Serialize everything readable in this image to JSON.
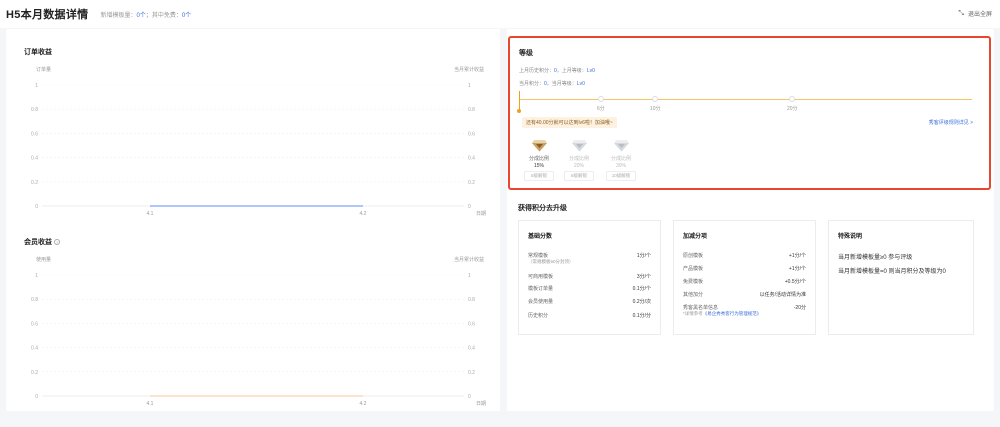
{
  "header": {
    "title": "H5本月数据详情",
    "new_label": "新增模板量：",
    "new_value": "0个",
    "free_label": "；其中免费：",
    "free_value": "0个",
    "exit_label": "退出全屏"
  },
  "chart_data": [
    {
      "type": "line",
      "title": "订单收益",
      "ylabel_left": "订单量",
      "ylabel_right": "当月累计收益",
      "xlabel": "日期",
      "categories": [
        "4.1",
        "4.2"
      ],
      "y_ticks": [
        "0",
        "0.2",
        "0.4",
        "0.6",
        "0.8",
        "1"
      ],
      "ylim": [
        0,
        1
      ],
      "series": [
        {
          "values": [
            0,
            0
          ],
          "color": "#5b8ff9"
        }
      ]
    },
    {
      "type": "line",
      "title": "会员收益",
      "ylabel_left": "使用量",
      "ylabel_right": "当月累计收益",
      "xlabel": "日期",
      "categories": [
        "4.1",
        "4.2"
      ],
      "y_ticks": [
        "0",
        "0.2",
        "0.4",
        "0.6",
        "0.8",
        "1"
      ],
      "ylim": [
        0,
        1
      ],
      "series": [
        {
          "values": [
            0,
            0
          ],
          "color": "#f6c99a"
        }
      ]
    }
  ],
  "level": {
    "title": "等级",
    "last_points_label": "上月历史积分：",
    "last_points": "0",
    "last_level_label": "，上月等级：",
    "last_level": "Lv0",
    "cur_points_label": "当月积分：",
    "cur_points": "0",
    "cur_level_label": "，当月等级：",
    "cur_level": "Lv0",
    "ticks": [
      "6分",
      "10分",
      "20分"
    ],
    "tip": "还有40.00分就可以达到lv6啦！加油哦~",
    "rules_link": "秀客评级规则详见 >",
    "badges": [
      {
        "l1": "分成比例",
        "l2": "15%",
        "l3": "5级解锁",
        "color": "#b8863b"
      },
      {
        "l1": "分成比例",
        "l2": "20%",
        "l3": "6级解锁",
        "color": "#cfd3d8"
      },
      {
        "l1": "分成比例",
        "l2": "30%",
        "l3": "10级解锁",
        "color": "#cfd3d8"
      }
    ]
  },
  "upgrade": {
    "title": "获得积分去升级",
    "basic": {
      "title": "基础分数",
      "rows": [
        {
          "k": "常规模板",
          "sub": "（常规模板60分封顶）",
          "v": "1分/个"
        },
        {
          "k": "可商用模板",
          "v": "3分/个"
        },
        {
          "k": "模板订单量",
          "v": "0.1分/个"
        },
        {
          "k": "会员使用量",
          "v": "0.2分/次"
        },
        {
          "k": "历史积分",
          "v": "0.1分/分"
        }
      ]
    },
    "bonus": {
      "title": "加减分项",
      "rows": [
        {
          "k": "原创模板",
          "v": "+1分/个"
        },
        {
          "k": "产品模板",
          "v": "+1分/个"
        },
        {
          "k": "免费模板",
          "v": "+0.5分/个"
        },
        {
          "k": "其他加分",
          "v": "以任务/活动详情为准"
        },
        {
          "k": "秀客黑名单信息",
          "v": "-20分",
          "sub": "*详情参考",
          "link": "《易企秀秀客行为管理规范》"
        }
      ]
    },
    "special": {
      "title": "特殊说明",
      "notes": [
        "当月新增模板量≥0 参与评级",
        "当月新增模板量=0 则当月积分及等级为0"
      ]
    }
  }
}
